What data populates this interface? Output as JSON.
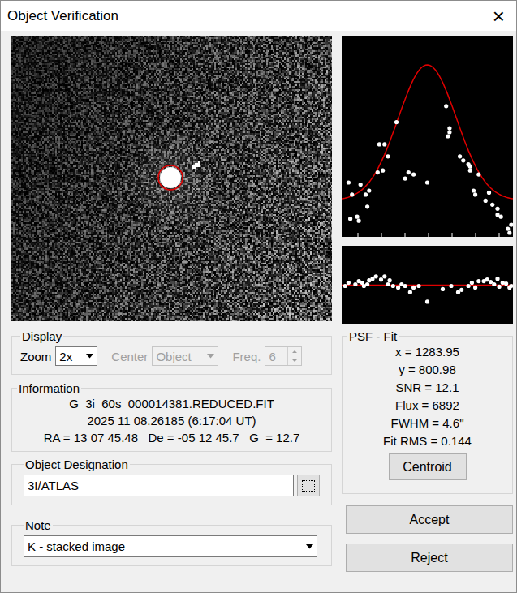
{
  "window": {
    "title": "Object Verification",
    "close": "×"
  },
  "psf_plot": {
    "curve": {
      "baseline": 0.18,
      "peak": 0.855,
      "center": 0.5,
      "sigma": 0.17
    },
    "points": [
      [
        0.04,
        0.27
      ],
      [
        0.06,
        0.21
      ],
      [
        0.11,
        0.26
      ],
      [
        0.14,
        0.21
      ],
      [
        0.16,
        0.23
      ],
      [
        0.05,
        0.09
      ],
      [
        0.09,
        0.1
      ],
      [
        0.1,
        0.08
      ],
      [
        0.15,
        0.15
      ],
      [
        0.21,
        0.32
      ],
      [
        0.22,
        0.46
      ],
      [
        0.25,
        0.46
      ],
      [
        0.24,
        0.33
      ],
      [
        0.27,
        0.4
      ],
      [
        0.32,
        0.57
      ],
      [
        0.37,
        0.29
      ],
      [
        0.39,
        0.32
      ],
      [
        0.42,
        0.31
      ],
      [
        0.5,
        0.27
      ],
      [
        0.61,
        0.65
      ],
      [
        0.63,
        0.54
      ],
      [
        0.62,
        0.5
      ],
      [
        0.63,
        0.52
      ],
      [
        0.69,
        0.4
      ],
      [
        0.71,
        0.38
      ],
      [
        0.74,
        0.36
      ],
      [
        0.75,
        0.35
      ],
      [
        0.75,
        0.33
      ],
      [
        0.77,
        0.23
      ],
      [
        0.78,
        0.21
      ],
      [
        0.8,
        0.31
      ],
      [
        0.84,
        0.18
      ],
      [
        0.86,
        0.22
      ],
      [
        0.88,
        0.16
      ],
      [
        0.91,
        0.14
      ],
      [
        0.91,
        0.11
      ],
      [
        0.93,
        0.1
      ],
      [
        0.99,
        0.06
      ],
      [
        0.97,
        0.04
      ],
      [
        0.98,
        0.02
      ]
    ]
  },
  "residual_plot": {
    "points": [
      [
        0.02,
        -0.01
      ],
      [
        0.04,
        0.03
      ],
      [
        0.08,
        0.01
      ],
      [
        0.1,
        0.05
      ],
      [
        0.12,
        0.03
      ],
      [
        0.13,
        -0.01
      ],
      [
        0.15,
        0.01
      ],
      [
        0.16,
        0.06
      ],
      [
        0.18,
        0.08
      ],
      [
        0.2,
        0.11
      ],
      [
        0.23,
        0.07
      ],
      [
        0.25,
        0.11
      ],
      [
        0.27,
        0.01
      ],
      [
        0.28,
        0.06
      ],
      [
        0.3,
        -0.01
      ],
      [
        0.33,
        -0.03
      ],
      [
        0.35,
        0.01
      ],
      [
        0.37,
        -0.01
      ],
      [
        0.4,
        -0.09
      ],
      [
        0.42,
        -0.03
      ],
      [
        0.45,
        -0.01
      ],
      [
        0.5,
        -0.21
      ],
      [
        0.59,
        -0.05
      ],
      [
        0.64,
        -0.01
      ],
      [
        0.68,
        -0.09
      ],
      [
        0.7,
        -0.06
      ],
      [
        0.74,
        -0.01
      ],
      [
        0.76,
        0.03
      ],
      [
        0.78,
        -0.03
      ],
      [
        0.8,
        0.05
      ],
      [
        0.83,
        0.05
      ],
      [
        0.85,
        0.07
      ],
      [
        0.87,
        0.04
      ],
      [
        0.89,
        0.01
      ],
      [
        0.91,
        0.08
      ],
      [
        0.92,
        -0.02
      ],
      [
        0.94,
        0.03
      ],
      [
        0.96,
        0.02
      ],
      [
        0.98,
        -0.03
      ],
      [
        0.99,
        -0.01
      ]
    ]
  },
  "display": {
    "label": "Display",
    "zoom": {
      "label": "Zoom",
      "value": "2x",
      "disabled": false
    },
    "center": {
      "label": "Center",
      "value": "Object",
      "disabled": true
    },
    "freq": {
      "label": "Freq.",
      "value": "6",
      "disabled": true
    }
  },
  "information": {
    "label": "Information",
    "lines": [
      "G_3i_60s_000014381.REDUCED.FIT",
      "2025 11 08.26185 (6:17:04 UT)",
      "RA = 13 07 45.48   De = -05 12 45.7   G  = 12.7"
    ]
  },
  "designation": {
    "label": "Object Designation",
    "value": "3I/ATLAS"
  },
  "note": {
    "label": "Note",
    "value": "K - stacked image"
  },
  "psf_fit": {
    "label": "PSF - Fit",
    "rows": [
      "x = 1283.95",
      "y = 800.98",
      "SNR = 12.1",
      "Flux = 6892",
      "FWHM = 4.6\"",
      "Fit RMS = 0.144"
    ],
    "button": "Centroid"
  },
  "buttons": [
    "Accept",
    "Reject"
  ]
}
